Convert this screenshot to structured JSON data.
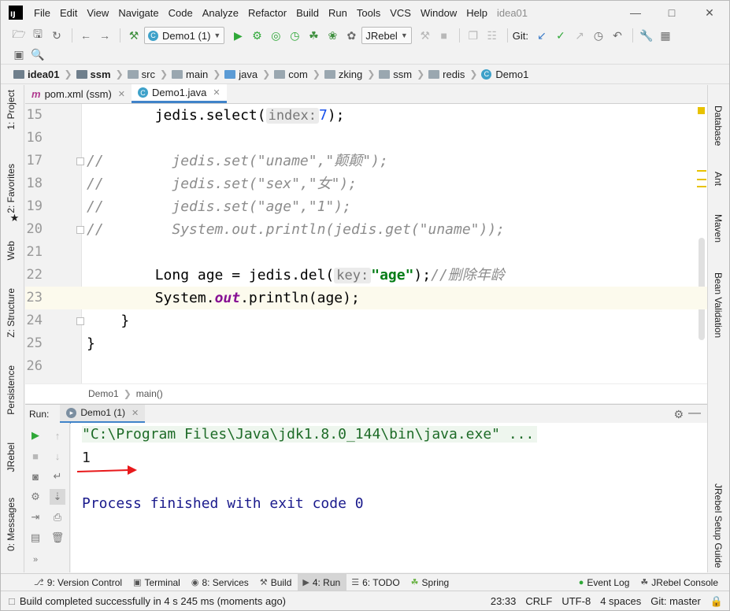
{
  "menubar": {
    "items": [
      "File",
      "Edit",
      "View",
      "Navigate",
      "Code",
      "Analyze",
      "Refactor",
      "Build",
      "Run",
      "Tools",
      "VCS",
      "Window",
      "Help"
    ],
    "project_title": "idea01",
    "app_icon_text": "IJ"
  },
  "toolbar": {
    "run_config": "Demo1 (1)",
    "jrebel": "JRebel",
    "git_label": "Git:"
  },
  "breadcrumb": [
    "idea01",
    "ssm",
    "src",
    "main",
    "java",
    "com",
    "zking",
    "ssm",
    "redis",
    "Demo1"
  ],
  "left_stripe": [
    "1: Project",
    "2: Favorites",
    "Web",
    "Z: Structure",
    "Persistence",
    "JRebel",
    "0: Messages"
  ],
  "right_stripe": [
    "Database",
    "Ant",
    "Maven",
    "Bean Validation",
    "JRebel Setup Guide"
  ],
  "editor_tabs": [
    {
      "label": "pom.xml (ssm)",
      "icon": "maven-m-icon"
    },
    {
      "label": "Demo1.java",
      "icon": "java-class-icon"
    }
  ],
  "code_lines": [
    {
      "num": "15",
      "current": false
    },
    {
      "num": "16",
      "current": false
    },
    {
      "num": "17",
      "current": false
    },
    {
      "num": "18",
      "current": false
    },
    {
      "num": "19",
      "current": false
    },
    {
      "num": "20",
      "current": false
    },
    {
      "num": "21",
      "current": false
    },
    {
      "num": "22",
      "current": false
    },
    {
      "num": "23",
      "current": true
    },
    {
      "num": "24",
      "current": false
    },
    {
      "num": "25",
      "current": false
    },
    {
      "num": "26",
      "current": false
    }
  ],
  "code": {
    "l15_a": "        jedis.select(",
    "l15_hint": "index:",
    "l15_num": "7",
    "l15_b": ");",
    "l17_cm": "//        jedis.set(\"uname\",\"颠颠\");",
    "l18_cm": "//        jedis.set(\"sex\",\"女\");",
    "l19_cm": "//        jedis.set(\"age\",\"1\");",
    "l20_cm": "//        System.out.println(jedis.get(\"uname\"));",
    "l22_a": "        Long age = jedis.del(",
    "l22_hint": "key:",
    "l22_str": "\"age\"",
    "l22_b": ");",
    "l22_cm": "//删除年龄",
    "l23_a": "        System.",
    "l23_field": "out",
    "l23_b": ".println(age);",
    "l24": "    }",
    "l25": "}"
  },
  "editor_breadcrumb": {
    "cls": "Demo1",
    "method": "main()"
  },
  "run_panel": {
    "label": "Run:",
    "tab": "Demo1 (1)",
    "cmd": "\"C:\\Program Files\\Java\\jdk1.8.0_144\\bin\\java.exe\" ...",
    "output": "1",
    "finished": "Process finished with exit code 0",
    "arrow_color": "#e8191b"
  },
  "bottom_tabs": [
    {
      "label": "9: Version Control",
      "icon": "vcs-icon"
    },
    {
      "label": "Terminal",
      "icon": "terminal-icon"
    },
    {
      "label": "8: Services",
      "icon": "services-icon"
    },
    {
      "label": "Build",
      "icon": "build-icon"
    },
    {
      "label": "4: Run",
      "icon": "run-icon",
      "active": true
    },
    {
      "label": "6: TODO",
      "icon": "todo-icon"
    },
    {
      "label": "Spring",
      "icon": "spring-icon"
    }
  ],
  "bottom_right_tabs": [
    {
      "label": "Event Log",
      "icon": "event-log-icon"
    },
    {
      "label": "JRebel Console",
      "icon": "jrebel-console-icon"
    }
  ],
  "status": {
    "message": "Build completed successfully in 4 s 245 ms (moments ago)",
    "position": "23:33",
    "line_sep": "CRLF",
    "encoding": "UTF-8",
    "indent": "4 spaces",
    "branch": "Git: master"
  },
  "colors": {
    "accent": "#4083c9",
    "string": "#067d17",
    "comment": "#8c8c8c",
    "current_line": "#fcfaed"
  }
}
